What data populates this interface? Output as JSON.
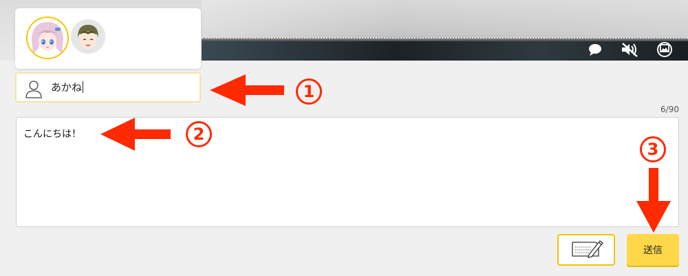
{
  "name_field": {
    "value": "あかね"
  },
  "message": {
    "text": "こんにちは！",
    "counter": "6/90"
  },
  "buttons": {
    "send_label": "送信"
  },
  "annotations": {
    "one": "1",
    "two": "2",
    "three": "3"
  },
  "video_icons": [
    "comment-icon",
    "mute-icon",
    "image-icon"
  ],
  "colors": {
    "accent_yellow": "#ffd84a",
    "annotation_red": "#ff2a00",
    "selected_border": "#f2c500"
  }
}
